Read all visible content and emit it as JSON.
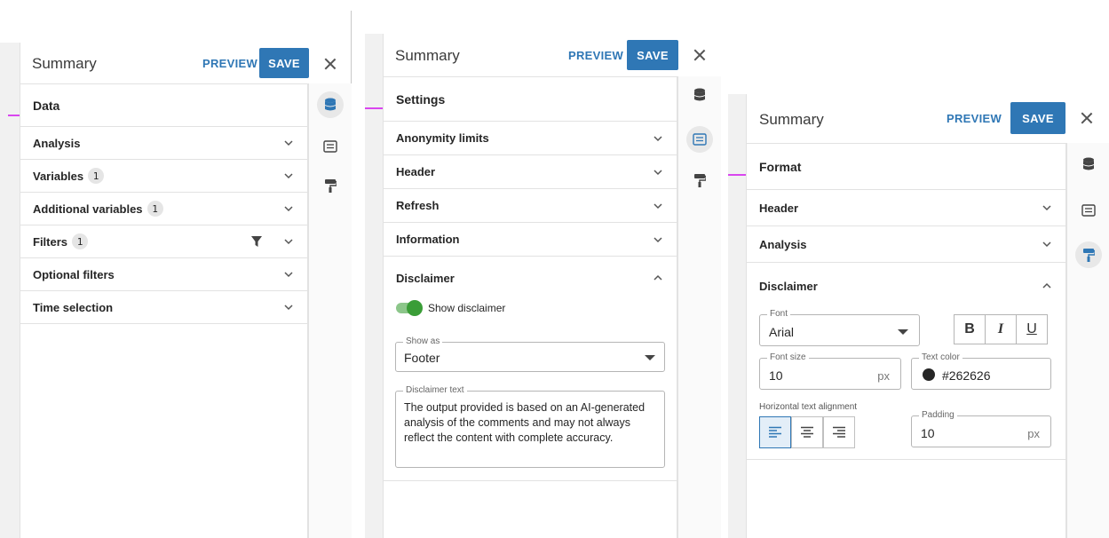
{
  "colors": {
    "accent": "#2f77b5",
    "toggle_on": "#3a9d37",
    "text_swatch": "#262626",
    "highlight_line": "#d946ef"
  },
  "panel1": {
    "title": "Summary",
    "preview_label": "PREVIEW",
    "save_label": "SAVE",
    "section_title": "Data",
    "rows": [
      {
        "label": "Analysis"
      },
      {
        "label": "Variables",
        "badge": "1"
      },
      {
        "label": "Additional variables",
        "badge": "1"
      },
      {
        "label": "Filters",
        "badge": "1"
      },
      {
        "label": "Optional filters"
      },
      {
        "label": "Time selection"
      }
    ],
    "rail_icons": [
      "database-icon",
      "comment-icon",
      "paint-roller-icon"
    ],
    "active_rail": "database-icon"
  },
  "panel2": {
    "title": "Summary",
    "preview_label": "PREVIEW",
    "save_label": "SAVE",
    "section_title": "Settings",
    "rows": [
      {
        "label": "Anonymity limits"
      },
      {
        "label": "Header"
      },
      {
        "label": "Refresh"
      },
      {
        "label": "Information"
      },
      {
        "label": "Disclaimer",
        "expanded": true
      }
    ],
    "toggle_label": "Show disclaimer",
    "show_as_label": "Show as",
    "show_as_value": "Footer",
    "disclaimer_label": "Disclaimer text",
    "disclaimer_text": "The output provided is based on an AI-generated analysis of the comments and may not always reflect the content with complete accuracy.",
    "rail_icons": [
      "database-icon",
      "comment-icon",
      "paint-roller-icon"
    ],
    "active_rail": "comment-icon"
  },
  "panel3": {
    "title": "Summary",
    "preview_label": "PREVIEW",
    "save_label": "SAVE",
    "section_title": "Format",
    "rows": [
      {
        "label": "Header"
      },
      {
        "label": "Analysis"
      },
      {
        "label": "Disclaimer",
        "expanded": true
      }
    ],
    "font_label": "Font",
    "font_value": "Arial",
    "bold": "B",
    "italic": "I",
    "underline": "U",
    "font_size_label": "Font size",
    "font_size_value": "10",
    "font_size_unit": "px",
    "text_color_label": "Text color",
    "text_color_value": "#262626",
    "alignment_label": "Horizontal text alignment",
    "padding_label": "Padding",
    "padding_value": "10",
    "padding_unit": "px",
    "rail_icons": [
      "database-icon",
      "comment-icon",
      "paint-roller-icon"
    ],
    "active_rail": "paint-roller-icon"
  }
}
